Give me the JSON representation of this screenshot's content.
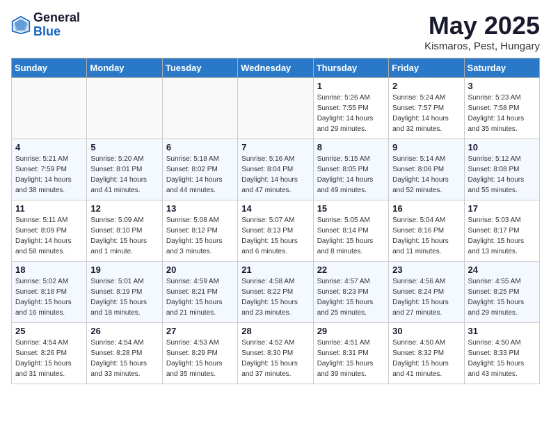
{
  "header": {
    "logo_general": "General",
    "logo_blue": "Blue",
    "month_title": "May 2025",
    "subtitle": "Kismaros, Pest, Hungary"
  },
  "days_of_week": [
    "Sunday",
    "Monday",
    "Tuesday",
    "Wednesday",
    "Thursday",
    "Friday",
    "Saturday"
  ],
  "weeks": [
    [
      {
        "num": "",
        "sunrise": "",
        "sunset": "",
        "daylight": ""
      },
      {
        "num": "",
        "sunrise": "",
        "sunset": "",
        "daylight": ""
      },
      {
        "num": "",
        "sunrise": "",
        "sunset": "",
        "daylight": ""
      },
      {
        "num": "",
        "sunrise": "",
        "sunset": "",
        "daylight": ""
      },
      {
        "num": "1",
        "sunrise": "Sunrise: 5:26 AM",
        "sunset": "Sunset: 7:55 PM",
        "daylight": "Daylight: 14 hours and 29 minutes."
      },
      {
        "num": "2",
        "sunrise": "Sunrise: 5:24 AM",
        "sunset": "Sunset: 7:57 PM",
        "daylight": "Daylight: 14 hours and 32 minutes."
      },
      {
        "num": "3",
        "sunrise": "Sunrise: 5:23 AM",
        "sunset": "Sunset: 7:58 PM",
        "daylight": "Daylight: 14 hours and 35 minutes."
      }
    ],
    [
      {
        "num": "4",
        "sunrise": "Sunrise: 5:21 AM",
        "sunset": "Sunset: 7:59 PM",
        "daylight": "Daylight: 14 hours and 38 minutes."
      },
      {
        "num": "5",
        "sunrise": "Sunrise: 5:20 AM",
        "sunset": "Sunset: 8:01 PM",
        "daylight": "Daylight: 14 hours and 41 minutes."
      },
      {
        "num": "6",
        "sunrise": "Sunrise: 5:18 AM",
        "sunset": "Sunset: 8:02 PM",
        "daylight": "Daylight: 14 hours and 44 minutes."
      },
      {
        "num": "7",
        "sunrise": "Sunrise: 5:16 AM",
        "sunset": "Sunset: 8:04 PM",
        "daylight": "Daylight: 14 hours and 47 minutes."
      },
      {
        "num": "8",
        "sunrise": "Sunrise: 5:15 AM",
        "sunset": "Sunset: 8:05 PM",
        "daylight": "Daylight: 14 hours and 49 minutes."
      },
      {
        "num": "9",
        "sunrise": "Sunrise: 5:14 AM",
        "sunset": "Sunset: 8:06 PM",
        "daylight": "Daylight: 14 hours and 52 minutes."
      },
      {
        "num": "10",
        "sunrise": "Sunrise: 5:12 AM",
        "sunset": "Sunset: 8:08 PM",
        "daylight": "Daylight: 14 hours and 55 minutes."
      }
    ],
    [
      {
        "num": "11",
        "sunrise": "Sunrise: 5:11 AM",
        "sunset": "Sunset: 8:09 PM",
        "daylight": "Daylight: 14 hours and 58 minutes."
      },
      {
        "num": "12",
        "sunrise": "Sunrise: 5:09 AM",
        "sunset": "Sunset: 8:10 PM",
        "daylight": "Daylight: 15 hours and 1 minute."
      },
      {
        "num": "13",
        "sunrise": "Sunrise: 5:08 AM",
        "sunset": "Sunset: 8:12 PM",
        "daylight": "Daylight: 15 hours and 3 minutes."
      },
      {
        "num": "14",
        "sunrise": "Sunrise: 5:07 AM",
        "sunset": "Sunset: 8:13 PM",
        "daylight": "Daylight: 15 hours and 6 minutes."
      },
      {
        "num": "15",
        "sunrise": "Sunrise: 5:05 AM",
        "sunset": "Sunset: 8:14 PM",
        "daylight": "Daylight: 15 hours and 8 minutes."
      },
      {
        "num": "16",
        "sunrise": "Sunrise: 5:04 AM",
        "sunset": "Sunset: 8:16 PM",
        "daylight": "Daylight: 15 hours and 11 minutes."
      },
      {
        "num": "17",
        "sunrise": "Sunrise: 5:03 AM",
        "sunset": "Sunset: 8:17 PM",
        "daylight": "Daylight: 15 hours and 13 minutes."
      }
    ],
    [
      {
        "num": "18",
        "sunrise": "Sunrise: 5:02 AM",
        "sunset": "Sunset: 8:18 PM",
        "daylight": "Daylight: 15 hours and 16 minutes."
      },
      {
        "num": "19",
        "sunrise": "Sunrise: 5:01 AM",
        "sunset": "Sunset: 8:19 PM",
        "daylight": "Daylight: 15 hours and 18 minutes."
      },
      {
        "num": "20",
        "sunrise": "Sunrise: 4:59 AM",
        "sunset": "Sunset: 8:21 PM",
        "daylight": "Daylight: 15 hours and 21 minutes."
      },
      {
        "num": "21",
        "sunrise": "Sunrise: 4:58 AM",
        "sunset": "Sunset: 8:22 PM",
        "daylight": "Daylight: 15 hours and 23 minutes."
      },
      {
        "num": "22",
        "sunrise": "Sunrise: 4:57 AM",
        "sunset": "Sunset: 8:23 PM",
        "daylight": "Daylight: 15 hours and 25 minutes."
      },
      {
        "num": "23",
        "sunrise": "Sunrise: 4:56 AM",
        "sunset": "Sunset: 8:24 PM",
        "daylight": "Daylight: 15 hours and 27 minutes."
      },
      {
        "num": "24",
        "sunrise": "Sunrise: 4:55 AM",
        "sunset": "Sunset: 8:25 PM",
        "daylight": "Daylight: 15 hours and 29 minutes."
      }
    ],
    [
      {
        "num": "25",
        "sunrise": "Sunrise: 4:54 AM",
        "sunset": "Sunset: 8:26 PM",
        "daylight": "Daylight: 15 hours and 31 minutes."
      },
      {
        "num": "26",
        "sunrise": "Sunrise: 4:54 AM",
        "sunset": "Sunset: 8:28 PM",
        "daylight": "Daylight: 15 hours and 33 minutes."
      },
      {
        "num": "27",
        "sunrise": "Sunrise: 4:53 AM",
        "sunset": "Sunset: 8:29 PM",
        "daylight": "Daylight: 15 hours and 35 minutes."
      },
      {
        "num": "28",
        "sunrise": "Sunrise: 4:52 AM",
        "sunset": "Sunset: 8:30 PM",
        "daylight": "Daylight: 15 hours and 37 minutes."
      },
      {
        "num": "29",
        "sunrise": "Sunrise: 4:51 AM",
        "sunset": "Sunset: 8:31 PM",
        "daylight": "Daylight: 15 hours and 39 minutes."
      },
      {
        "num": "30",
        "sunrise": "Sunrise: 4:50 AM",
        "sunset": "Sunset: 8:32 PM",
        "daylight": "Daylight: 15 hours and 41 minutes."
      },
      {
        "num": "31",
        "sunrise": "Sunrise: 4:50 AM",
        "sunset": "Sunset: 8:33 PM",
        "daylight": "Daylight: 15 hours and 43 minutes."
      }
    ]
  ]
}
